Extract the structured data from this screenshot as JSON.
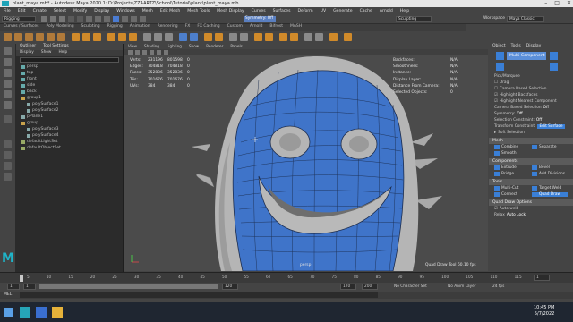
{
  "window": {
    "icon_name": "maya-app-icon",
    "title": "plant_maya.mb* - Autodesk Maya 2020.1: D:\\Projects\\ZZAARTZ\\School\\Tutorial\\plant\\plant_maya.mb",
    "controls": [
      "–",
      "□",
      "✕"
    ]
  },
  "menubar": [
    "File",
    "Edit",
    "Create",
    "Select",
    "Modify",
    "Display",
    "Windows",
    "Mesh",
    "Edit Mesh",
    "Mesh Tools",
    "Mesh Display",
    "Curves",
    "Surfaces",
    "Deform",
    "UV",
    "Generate",
    "Cache",
    "Arnold",
    "Help"
  ],
  "statusline": {
    "mode": "Rigging",
    "workspace_label": "Workspace",
    "workspace_value": "Maya Classic",
    "symmetry": "Symmetry: Off",
    "search_value": "Sculpting"
  },
  "shelf_tabs": [
    "Curves / Surfaces",
    "Poly Modeling",
    "Sculpting",
    "Rigging",
    "Animation",
    "Rendering",
    "FX",
    "FX Caching",
    "Custom",
    "Arnold",
    "Bifrost",
    "MASH",
    "Motion Graphics",
    "XGen"
  ],
  "outliner": {
    "title": "Outliner",
    "second_tab": "Tool Settings",
    "menu": [
      "Display",
      "Show",
      "Help"
    ],
    "items": [
      "persp",
      "top",
      "front",
      "side",
      "back",
      "group1",
      "polySurface1",
      "polySurface2",
      "pPlane1",
      "group",
      "polySurface3",
      "polySurface4",
      "defaultLightSet",
      "defaultObjectSet"
    ]
  },
  "viewport": {
    "menu": [
      "View",
      "Shading",
      "Lighting",
      "Show",
      "Renderer",
      "Panels"
    ],
    "hud_left": [
      {
        "label": "Verts:",
        "a": "231196",
        "b": "801598",
        "c": "0"
      },
      {
        "label": "Edges:",
        "a": "704818",
        "b": "704818",
        "c": "0"
      },
      {
        "label": "Faces:",
        "a": "352836",
        "b": "352836",
        "c": "0"
      },
      {
        "label": "Tris:",
        "a": "701676",
        "b": "701676",
        "c": "0"
      },
      {
        "label": "UVs:",
        "a": "384",
        "b": "384",
        "c": "0"
      }
    ],
    "hud_right": [
      {
        "label": "Backfaces:",
        "v": "N/A"
      },
      {
        "label": "Smoothness:",
        "v": "N/A"
      },
      {
        "label": "Instance:",
        "v": "N/A"
      },
      {
        "label": "Display Layer:",
        "v": "N/A"
      },
      {
        "label": "Distance From Camera:",
        "v": "N/A"
      },
      {
        "label": "Selected Objects:",
        "v": "0"
      }
    ],
    "camera": "persp",
    "bottom_label": "Quad Draw Tool",
    "fps": "60.10 fps",
    "colors": {
      "face_fill": "#3f74c9",
      "bg": "#4a4a4a"
    }
  },
  "attribute_panel": {
    "tabs": [
      "Object",
      "Tools",
      "Display"
    ],
    "tool_name": "Multi-Component",
    "section_pick": "Pick/Marquee",
    "options": [
      "Drag",
      "Camera Based Selection",
      "Highlight Backfaces",
      "Highlight Nearest Component"
    ],
    "camera_based": "Camera Based Selection",
    "camera_based_state": "Off",
    "symmetry_label": "Symmetry:",
    "symmetry_state": "Off",
    "sel_constraint": "Selection Constraint:",
    "sel_constraint_value": "Off",
    "transform_constraint": "Transform Constraint:",
    "transform_constraint_value": "Edit Surface",
    "soft_selection": "Soft Selection",
    "mesh_section": "Mesh",
    "mesh_buttons": [
      "Combine",
      "Separate",
      "Smooth"
    ],
    "components_section": "Components",
    "components_buttons": [
      "Extrude",
      "Bevel",
      "Bridge",
      "Add Divisions"
    ],
    "tools_section": "Tools",
    "tools_buttons": [
      "Multi-Cut",
      "Target Weld",
      "Connect",
      "Quad Draw"
    ],
    "quad_draw_section": "Quad Draw Options",
    "relax_label": "Relax",
    "auto_weld": "Auto weld",
    "relax_value": "Auto Lock"
  },
  "timeline": {
    "ticks": [
      "5",
      "10",
      "15",
      "20",
      "25",
      "30",
      "35",
      "40",
      "45",
      "50",
      "55",
      "60",
      "65",
      "70",
      "75",
      "80",
      "85",
      "90",
      "95",
      "100",
      "105",
      "110",
      "115",
      "120"
    ],
    "current_frame": "1"
  },
  "range": {
    "start": "1",
    "inner_start": "1",
    "inner_end": "120",
    "end": "120",
    "end2": "200",
    "character_set": "No Character Set",
    "anim_layer": "No Anim Layer",
    "fps_label": "24 fps"
  },
  "commandline": {
    "lang": "MEL"
  },
  "taskbar": {
    "clock": "10:45 PM",
    "date": "5/7/2022"
  }
}
